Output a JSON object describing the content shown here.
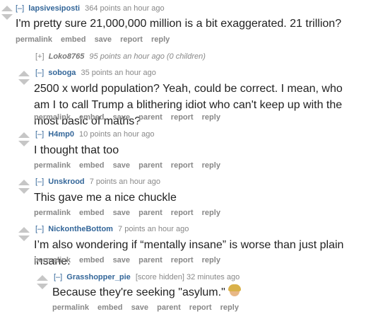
{
  "buttons": {
    "permalink": "permalink",
    "embed": "embed",
    "save": "save",
    "parent": "parent",
    "report": "report",
    "reply": "reply"
  },
  "comments": [
    {
      "toggle": "[–]",
      "author": "lapsivesiposti",
      "meta": "364 points an hour ago",
      "body": "I'm pretty sure 21,000,000 million is a bit exaggerated. 21 trillion?"
    },
    {
      "toggle": "[+]",
      "author": "Loko8765",
      "meta": "95 points an hour ago (0 children)"
    },
    {
      "toggle": "[–]",
      "author": "soboga",
      "meta": "35 points an hour ago",
      "body": "2500 x world population? Yeah, could be correct. I mean, who am I to call Trump a blithering idiot who can't keep up with the most basic of maths?"
    },
    {
      "toggle": "[–]",
      "author": "H4mp0",
      "meta": "10 points an hour ago",
      "body": "I thought that too"
    },
    {
      "toggle": "[–]",
      "author": "Unskrood",
      "meta": "7 points an hour ago",
      "body": "This gave me a nice chuckle"
    },
    {
      "toggle": "[–]",
      "author": "NickontheBottom",
      "meta": "7 points an hour ago",
      "body": "I’m also wondering if “mentally insane” is worse than just plain insane."
    },
    {
      "toggle": "[–]",
      "author": "Grasshopper_pie",
      "meta": "[score hidden] 32 minutes ago",
      "body": "Because they're seeking \"asylum.\"",
      "emoji": "woman-facepalming"
    }
  ]
}
